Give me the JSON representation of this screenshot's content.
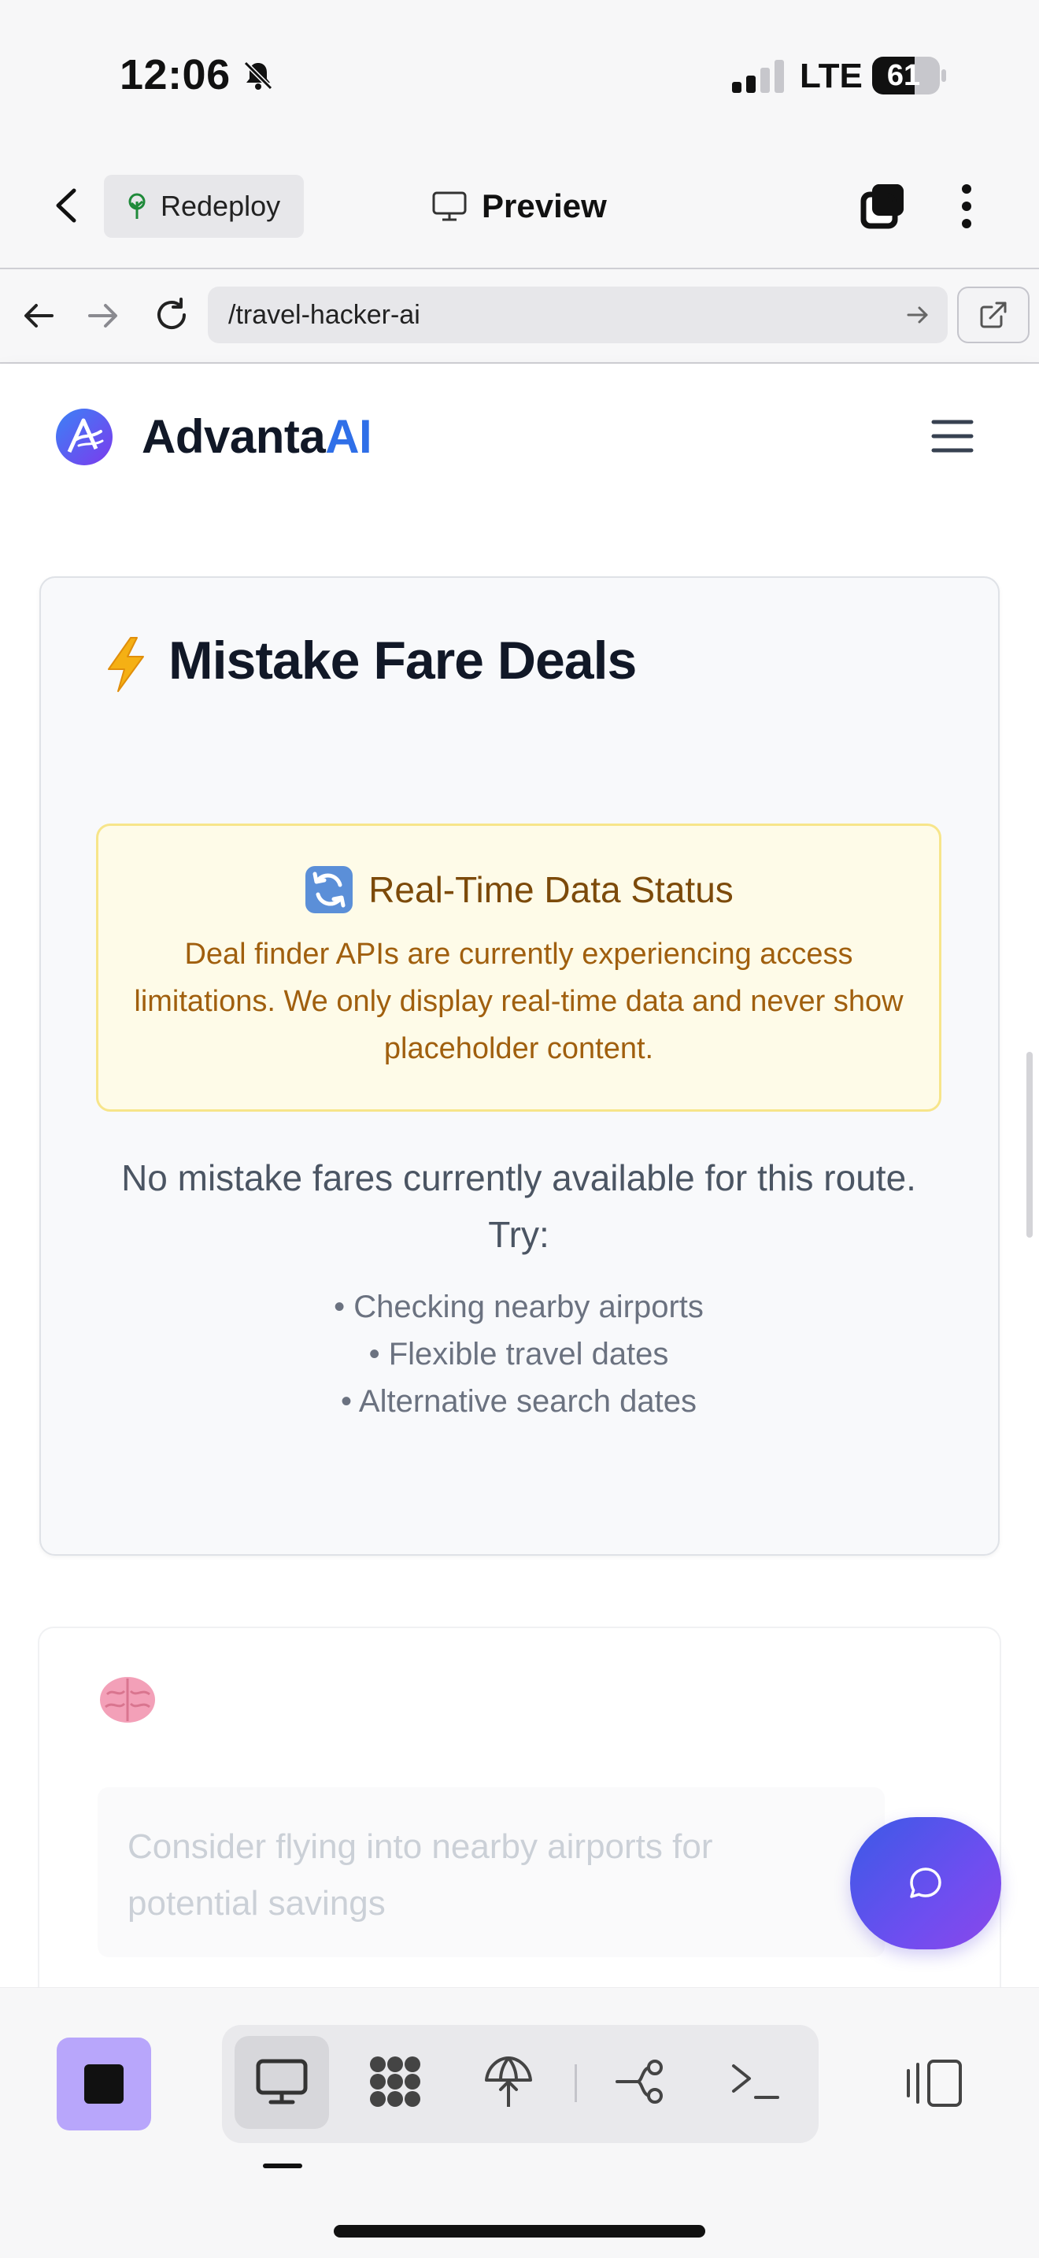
{
  "status_bar": {
    "time": "12:06",
    "network": "LTE",
    "battery": "61"
  },
  "app_header": {
    "redeploy_label": "Redeploy",
    "preview_label": "Preview"
  },
  "browser": {
    "url": "/travel-hacker-ai"
  },
  "site": {
    "brand_main": "Advanta",
    "brand_accent": "AI"
  },
  "deals_card": {
    "title": "Mistake Fare Deals",
    "notice_title": "Real-Time Data Status",
    "notice_body": "Deal finder APIs are currently experiencing access limitations. We only display real-time data and never show placeholder content.",
    "empty_message": "No mistake fares currently available for this route. Try:",
    "tips": [
      "• Checking nearby airports",
      "• Flexible travel dates",
      "• Alternative search dates"
    ]
  },
  "insight_card": {
    "text": "Consider flying into nearby airports for potential savings"
  },
  "colors": {
    "brand_accent": "#2f6fe8",
    "notice_bg": "#fefbe8",
    "notice_border": "#f7e58a",
    "notice_text": "#a05f0e",
    "stop_button": "#b8a6fb",
    "chat_fab_start": "#3b5ae6",
    "chat_fab_end": "#8b47ea"
  },
  "icons": {
    "bell": "bell-slash-icon",
    "back": "chevron-left-icon",
    "redeploy": "tree-icon",
    "preview": "monitor-icon",
    "tabs": "tabs-icon",
    "more": "more-vertical-icon",
    "refresh": "refresh-emoji-icon",
    "bolt": "lightning-icon",
    "brain": "brain-icon",
    "chat": "chat-bubble-icon"
  }
}
